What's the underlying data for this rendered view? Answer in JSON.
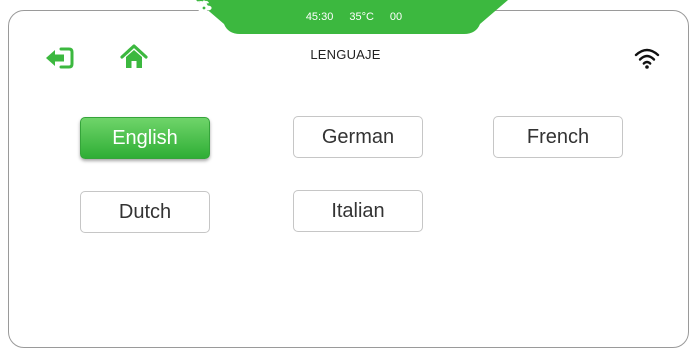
{
  "status_bar": {
    "timer_icon": "alarm-clock-icon",
    "timer_value": "45:30",
    "temperature_icon": "thermometer-icon",
    "temperature_value": "35°C",
    "fan_icon": "fan-icon",
    "fan_value": "00"
  },
  "header": {
    "back_icon": "exit-arrow-icon",
    "home_icon": "home-icon",
    "title": "LENGUAJE",
    "wifi_icon": "wifi-icon"
  },
  "languages": [
    {
      "label": "English",
      "selected": true
    },
    {
      "label": "German",
      "selected": false
    },
    {
      "label": "French",
      "selected": false
    },
    {
      "label": "Dutch",
      "selected": false
    },
    {
      "label": "Italian",
      "selected": false
    }
  ],
  "colors": {
    "accent": "#3cb83f",
    "border": "#c6c6c6"
  }
}
